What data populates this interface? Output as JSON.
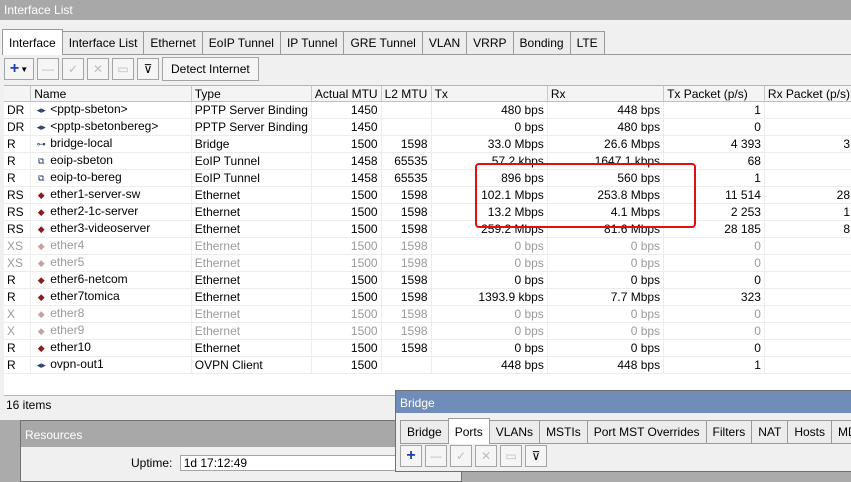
{
  "window_title": "Interface List",
  "tabs": [
    "Interface",
    "Interface List",
    "Ethernet",
    "EoIP Tunnel",
    "IP Tunnel",
    "GRE Tunnel",
    "VLAN",
    "VRRP",
    "Bonding",
    "LTE"
  ],
  "toolbar": {
    "detect_internet": "Detect Internet"
  },
  "columns": [
    "",
    "Name",
    "Type",
    "Actual MTU",
    "L2 MTU",
    "Tx",
    "Rx",
    "Tx Packet (p/s)",
    "Rx Packet (p/s)"
  ],
  "rows": [
    {
      "flags": "DR",
      "name": "<pptp-sbeton>",
      "type": "PPTP Server Binding",
      "mtu": "1450",
      "l2mtu": "",
      "tx": "480 bps",
      "rx": "448 bps",
      "txp": "1",
      "rxp": "",
      "icon": "tunnel-icon",
      "disabled": false
    },
    {
      "flags": "DR",
      "name": "<pptp-sbetonbereg>",
      "type": "PPTP Server Binding",
      "mtu": "1450",
      "l2mtu": "",
      "tx": "0 bps",
      "rx": "480 bps",
      "txp": "0",
      "rxp": "",
      "icon": "tunnel-icon",
      "disabled": false
    },
    {
      "flags": "R",
      "name": "bridge-local",
      "type": "Bridge",
      "mtu": "1500",
      "l2mtu": "1598",
      "tx": "33.0 Mbps",
      "rx": "26.6 Mbps",
      "txp": "4 393",
      "rxp": "3",
      "icon": "bridge-icon",
      "disabled": false
    },
    {
      "flags": "R",
      "name": "eoip-sbeton",
      "type": "EoIP Tunnel",
      "mtu": "1458",
      "l2mtu": "65535",
      "tx": "57.2 kbps",
      "rx": "1647.1 kbps",
      "txp": "68",
      "rxp": "",
      "icon": "eoip-icon",
      "disabled": false
    },
    {
      "flags": "R",
      "name": "eoip-to-bereg",
      "type": "EoIP Tunnel",
      "mtu": "1458",
      "l2mtu": "65535",
      "tx": "896 bps",
      "rx": "560 bps",
      "txp": "1",
      "rxp": "",
      "icon": "eoip-icon",
      "disabled": false
    },
    {
      "flags": "RS",
      "name": "ether1-server-sw",
      "type": "Ethernet",
      "mtu": "1500",
      "l2mtu": "1598",
      "tx": "102.1 Mbps",
      "rx": "253.8 Mbps",
      "txp": "11 514",
      "rxp": "28",
      "icon": "ethernet-icon",
      "disabled": false
    },
    {
      "flags": "RS",
      "name": "ether2-1c-server",
      "type": "Ethernet",
      "mtu": "1500",
      "l2mtu": "1598",
      "tx": "13.2 Mbps",
      "rx": "4.1 Mbps",
      "txp": "2 253",
      "rxp": "1",
      "icon": "ethernet-icon",
      "disabled": false
    },
    {
      "flags": "RS",
      "name": "ether3-videoserver",
      "type": "Ethernet",
      "mtu": "1500",
      "l2mtu": "1598",
      "tx": "259.2 Mbps",
      "rx": "81.6 Mbps",
      "txp": "28 185",
      "rxp": "8",
      "icon": "ethernet-icon",
      "disabled": false
    },
    {
      "flags": "XS",
      "name": "ether4",
      "type": "Ethernet",
      "mtu": "1500",
      "l2mtu": "1598",
      "tx": "0 bps",
      "rx": "0 bps",
      "txp": "0",
      "rxp": "",
      "icon": "ethernet-icon",
      "disabled": true
    },
    {
      "flags": "XS",
      "name": "ether5",
      "type": "Ethernet",
      "mtu": "1500",
      "l2mtu": "1598",
      "tx": "0 bps",
      "rx": "0 bps",
      "txp": "0",
      "rxp": "",
      "icon": "ethernet-icon",
      "disabled": true
    },
    {
      "flags": "R",
      "name": "ether6-netcom",
      "type": "Ethernet",
      "mtu": "1500",
      "l2mtu": "1598",
      "tx": "0 bps",
      "rx": "0 bps",
      "txp": "0",
      "rxp": "",
      "icon": "ethernet-icon",
      "disabled": false
    },
    {
      "flags": "R",
      "name": "ether7tomica",
      "type": "Ethernet",
      "mtu": "1500",
      "l2mtu": "1598",
      "tx": "1393.9 kbps",
      "rx": "7.7 Mbps",
      "txp": "323",
      "rxp": "",
      "icon": "ethernet-icon",
      "disabled": false
    },
    {
      "flags": "X",
      "name": "ether8",
      "type": "Ethernet",
      "mtu": "1500",
      "l2mtu": "1598",
      "tx": "0 bps",
      "rx": "0 bps",
      "txp": "0",
      "rxp": "",
      "icon": "ethernet-icon",
      "disabled": true
    },
    {
      "flags": "X",
      "name": "ether9",
      "type": "Ethernet",
      "mtu": "1500",
      "l2mtu": "1598",
      "tx": "0 bps",
      "rx": "0 bps",
      "txp": "0",
      "rxp": "",
      "icon": "ethernet-icon",
      "disabled": true
    },
    {
      "flags": "R",
      "name": "ether10",
      "type": "Ethernet",
      "mtu": "1500",
      "l2mtu": "1598",
      "tx": "0 bps",
      "rx": "0 bps",
      "txp": "0",
      "rxp": "",
      "icon": "ethernet-icon",
      "disabled": false
    },
    {
      "flags": "R",
      "name": "ovpn-out1",
      "type": "OVPN Client",
      "mtu": "1500",
      "l2mtu": "",
      "tx": "448 bps",
      "rx": "448 bps",
      "txp": "1",
      "rxp": "",
      "icon": "tunnel-icon",
      "disabled": false
    }
  ],
  "status": {
    "items": "16 items"
  },
  "resources": {
    "title": "Resources",
    "uptime_label": "Uptime:",
    "uptime_value": "1d 17:12:49"
  },
  "bridge": {
    "title": "Bridge",
    "tabs": [
      "Bridge",
      "Ports",
      "VLANs",
      "MSTIs",
      "Port MST Overrides",
      "Filters",
      "NAT",
      "Hosts",
      "MDB"
    ]
  },
  "colors": {
    "highlight": "#e01010",
    "titlebar": "#a8a8a8",
    "icon": "#2c3e6b"
  }
}
